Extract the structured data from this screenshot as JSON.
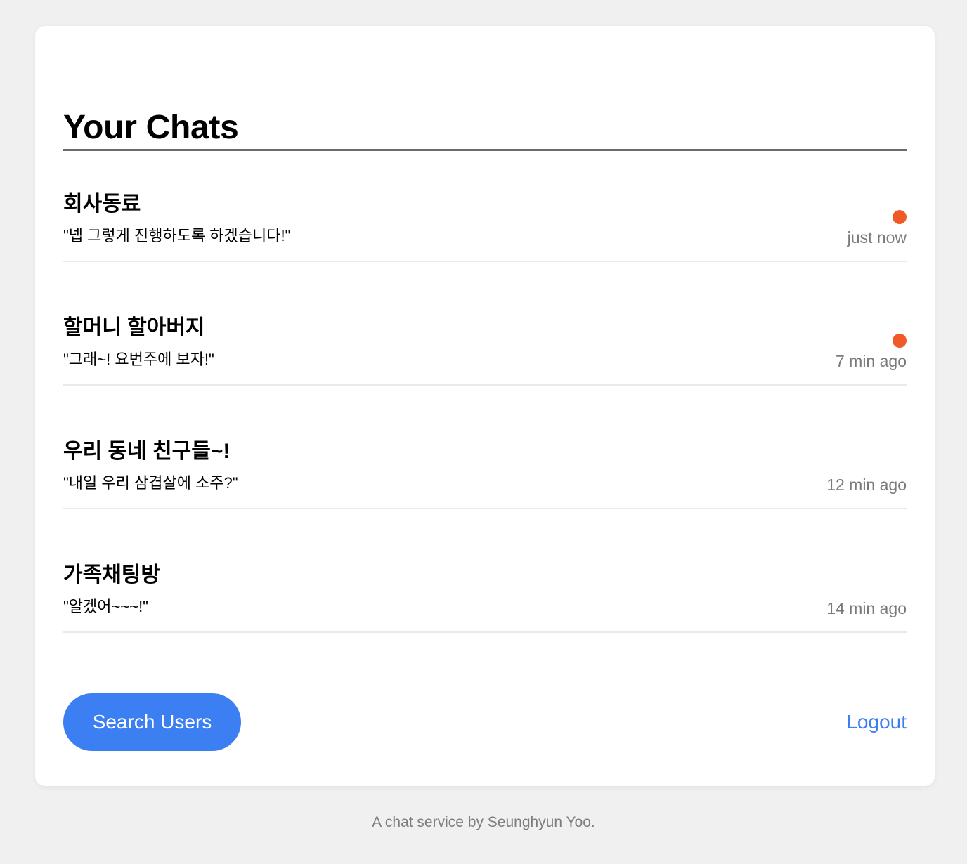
{
  "page": {
    "title": "Your Chats"
  },
  "colors": {
    "accent": "#3b7ff2",
    "unread": "#f05a28",
    "muted": "#7a7a7a"
  },
  "chats": [
    {
      "name": "회사동료",
      "preview": "\"넵 그렇게 진행하도록 하겠습니다!\"",
      "time": "just now",
      "unread": true
    },
    {
      "name": "할머니 할아버지",
      "preview": "\"그래~! 요번주에 보자!\"",
      "time": "7 min ago",
      "unread": true
    },
    {
      "name": "우리 동네 친구들~!",
      "preview": "\"내일 우리 삼겹살에 소주?\"",
      "time": "12 min ago",
      "unread": false
    },
    {
      "name": "가족채팅방",
      "preview": "\"알겠어~~~!\"",
      "time": "14 min ago",
      "unread": false
    }
  ],
  "actions": {
    "search_label": "Search Users",
    "logout_label": "Logout"
  },
  "footer": {
    "text": "A chat service by Seunghyun Yoo."
  }
}
